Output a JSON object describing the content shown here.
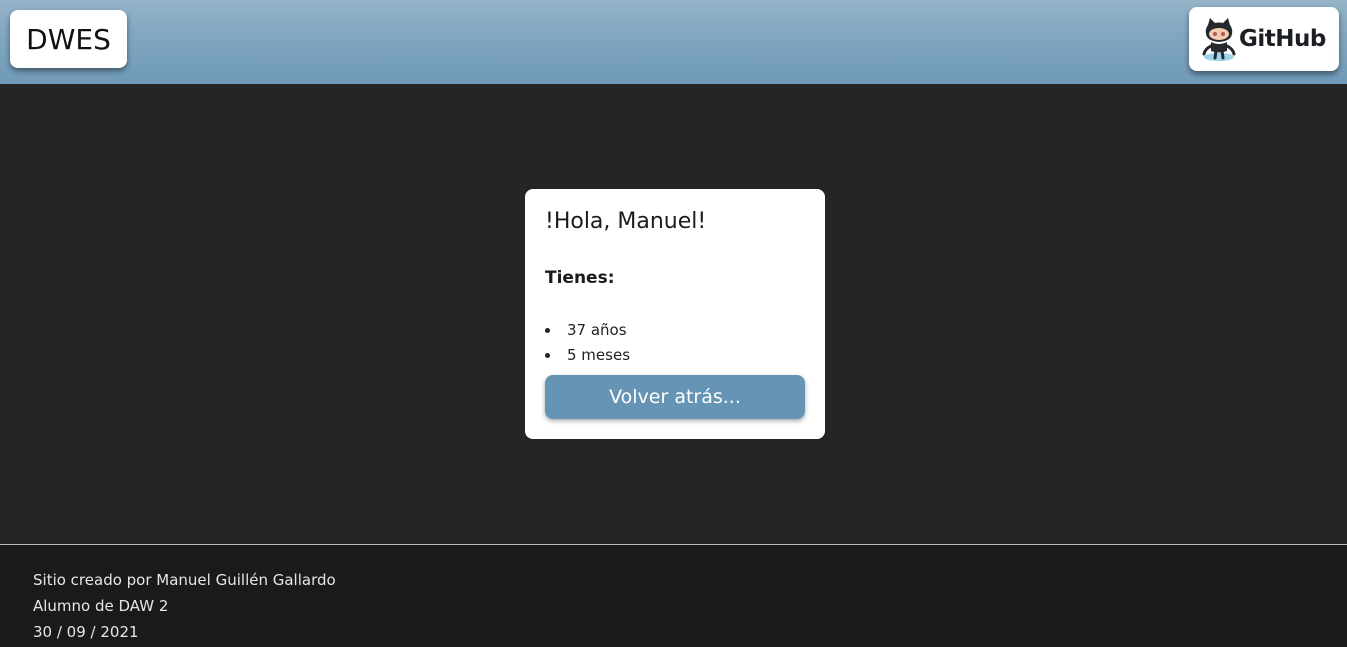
{
  "header": {
    "logo_text": "DWES",
    "github_label": "GitHub",
    "github_icon": "github-octocat-icon"
  },
  "card": {
    "greeting": "!Hola, Manuel!",
    "subtitle": "Tienes:",
    "items": [
      "37 años",
      "5 meses"
    ],
    "back_button_label": "Volver atrás..."
  },
  "footer": {
    "lines": [
      "Sitio creado por Manuel Guillén Gallardo",
      "Alumno de DAW 2",
      "30 / 09 / 2021"
    ]
  },
  "colors": {
    "header": "#80a6c0",
    "button": "#6694b4",
    "background": "#252525",
    "footer": "#1a1a1a"
  }
}
